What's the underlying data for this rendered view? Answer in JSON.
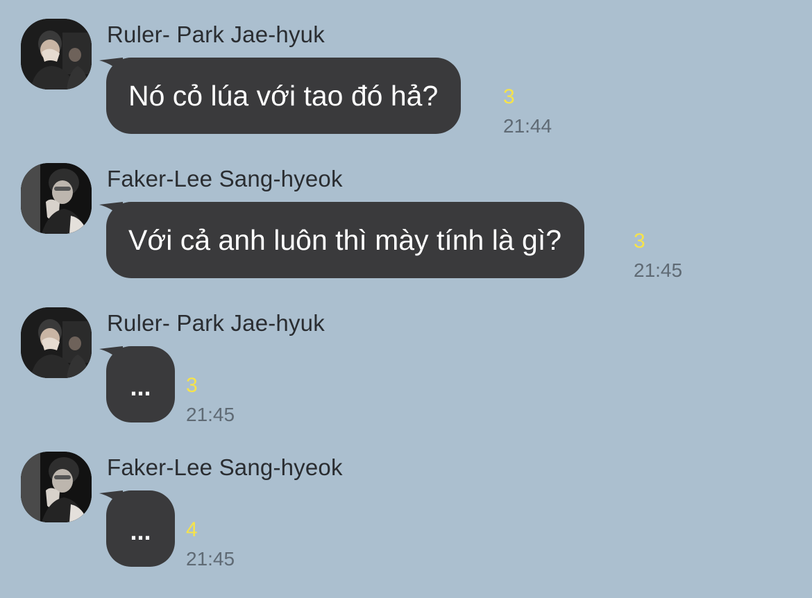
{
  "chat": {
    "colors": {
      "background": "#abbfcf",
      "bubble": "#3a3a3c",
      "bubble_text": "#ffffff",
      "unread_count": "#f6e34a",
      "timestamp": "#5f6a74",
      "sender_name": "#2a2d31"
    },
    "messages": [
      {
        "sender": "Ruler- Park Jae-hyuk",
        "avatar": "profile-photo-ruler",
        "text": "Nó cỏ lúa với tao đó hả?",
        "unread": "3",
        "time": "21:44"
      },
      {
        "sender": "Faker-Lee Sang-hyeok",
        "avatar": "profile-photo-faker",
        "text": "Với cả anh luôn thì mày tính là gì?",
        "unread": "3",
        "time": "21:45"
      },
      {
        "sender": "Ruler- Park Jae-hyuk",
        "avatar": "profile-photo-ruler",
        "text": "...",
        "unread": "3",
        "time": "21:45"
      },
      {
        "sender": "Faker-Lee Sang-hyeok",
        "avatar": "profile-photo-faker",
        "text": "...",
        "unread": "4",
        "time": "21:45"
      }
    ]
  }
}
